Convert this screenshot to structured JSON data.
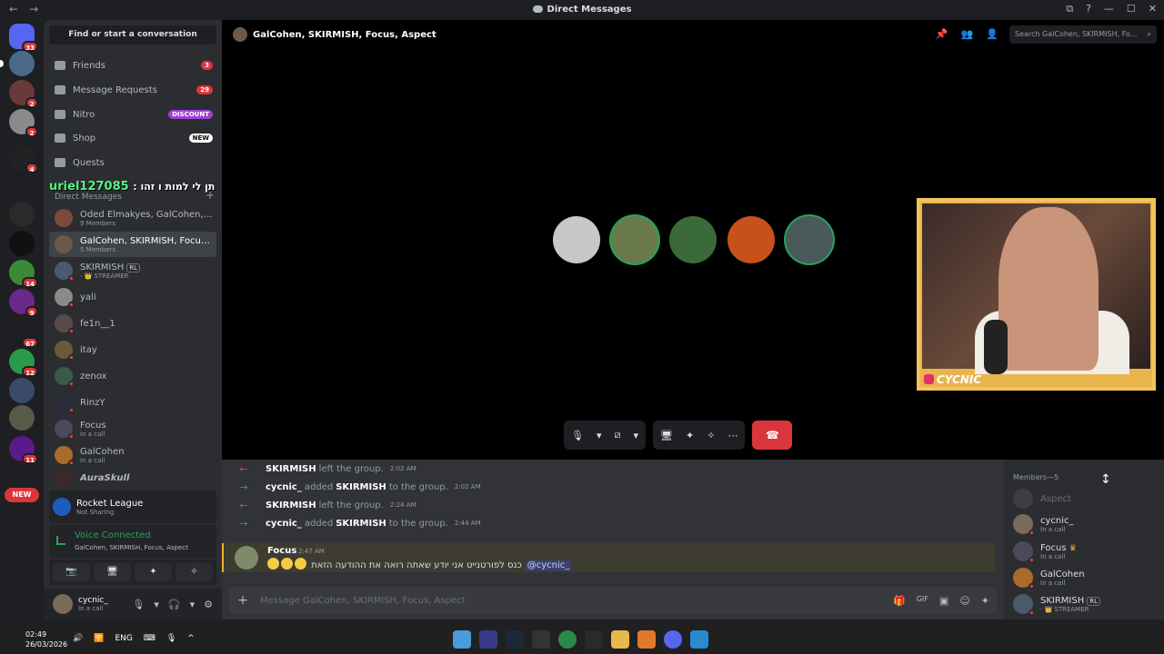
{
  "window": {
    "title": "Direct Messages",
    "nav_back": "←",
    "nav_forward": "→",
    "controls": [
      "⧉",
      "?",
      "—",
      "☐",
      "✕"
    ]
  },
  "servers": [
    {
      "name": "home",
      "badge": "33"
    },
    {
      "name": "server-1",
      "badge": ""
    },
    {
      "name": "server-2",
      "badge": "2"
    },
    {
      "name": "server-3",
      "badge": "2"
    },
    {
      "name": "server-4",
      "badge": "4"
    },
    {
      "name": "server-5",
      "badge": ""
    },
    {
      "name": "server-6",
      "badge": ""
    },
    {
      "name": "server-7",
      "badge": "14"
    },
    {
      "name": "server-8",
      "badge": "9"
    },
    {
      "name": "server-9",
      "badge": "67"
    },
    {
      "name": "server-10",
      "badge": "12"
    },
    {
      "name": "server-11",
      "badge": ""
    },
    {
      "name": "server-12",
      "badge": ""
    },
    {
      "name": "server-13",
      "badge": "11"
    }
  ],
  "new_pill": "NEW",
  "sidebar": {
    "find": "Find or start a conversation",
    "nav": [
      {
        "label": "Friends",
        "badge": "3"
      },
      {
        "label": "Message Requests",
        "badge": "29"
      },
      {
        "label": "Nitro",
        "badge": "DISCOUNT"
      },
      {
        "label": "Shop",
        "badge": "NEW"
      },
      {
        "label": "Quests",
        "badge": ""
      }
    ],
    "overlay_name": "uriel127085",
    "overlay_text": ": תן לי למות ו זהו",
    "dm_header": "Direct Messages",
    "dm_plus": "+",
    "dms": [
      {
        "name": "Oded Elmakyes, GalCohen, SK...",
        "sub": "9 Members"
      },
      {
        "name": "GalCohen, SKIRMISH, Focus, ...",
        "sub": "5 Members"
      },
      {
        "name": "SKIRMISH",
        "tag": "RL",
        "sub": "· 👑 STREAMER"
      },
      {
        "name": "yali",
        "sub": ""
      },
      {
        "name": "fe1n__1",
        "sub": ""
      },
      {
        "name": "itay",
        "sub": ""
      },
      {
        "name": "zenox",
        "sub": ""
      },
      {
        "name": "RinzY",
        "sub": ""
      },
      {
        "name": "Focus",
        "sub": "In a call"
      },
      {
        "name": "GalCohen",
        "sub": "In a call"
      },
      {
        "name": "AuraSkull",
        "sub": ""
      }
    ],
    "activity": {
      "title": "Rocket League",
      "sub": "Not Sharing"
    },
    "voice": {
      "status": "Voice Connected",
      "channel": "GalCohen, SKIRMISH, Focus, Aspect"
    },
    "voice_buttons": [
      "📷",
      "🖥",
      "✦",
      "✧"
    ],
    "user": {
      "name": "cycnic_",
      "status": "In a call"
    },
    "user_controls": [
      "🎙",
      "▾",
      "🎧",
      "▾",
      "⚙"
    ]
  },
  "header": {
    "title": "GalCohen, SKIRMISH, Focus, Aspect",
    "icons": [
      "📌",
      "👥",
      "👤"
    ],
    "search_placeholder": "Search GalCohen, SKIRMISH, Fo...",
    "search_icon": "⌕"
  },
  "call": {
    "participants": [
      "participant-1",
      "participant-2",
      "participant-3",
      "participant-4",
      "participant-5"
    ],
    "stream_label": "CYCNIC",
    "controls": {
      "mic": "🎙",
      "camera": "⧄",
      "share": "🖥",
      "activities": "✦",
      "soundboard": "✧",
      "more": "⋯",
      "hangup": "☎"
    }
  },
  "chat": {
    "system_messages": [
      {
        "arrow": "←",
        "actor": "SKIRMISH",
        "text": "left the group.",
        "target": "",
        "suffix": "",
        "time": "2:02 AM"
      },
      {
        "arrow": "→",
        "actor": "cycnic_",
        "text": "added",
        "target": "SKIRMISH",
        "suffix": "to the group.",
        "time": "2:02 AM"
      },
      {
        "arrow": "←",
        "actor": "SKIRMISH",
        "text": "left the group.",
        "target": "",
        "suffix": "",
        "time": "2:24 AM"
      },
      {
        "arrow": "→",
        "actor": "cycnic_",
        "text": "added",
        "target": "SKIRMISH",
        "suffix": "to the group.",
        "time": "2:44 AM"
      }
    ],
    "message": {
      "author": "Focus",
      "time": "2:47 AM",
      "text": "כנס לפורטנייט אני יודע שאתה רואה את ההודעה הזאת",
      "mention": "@cycnic_"
    },
    "composer_placeholder": "Message GalCohen, SKIRMISH, Focus, Aspect",
    "composer_plus": "+",
    "composer_icons": [
      "🎁",
      "GIF",
      "▣",
      "☺",
      "✦"
    ]
  },
  "members": {
    "header": "Members—5",
    "list": [
      {
        "name": "Aspect",
        "sub": "",
        "offline": true
      },
      {
        "name": "cycnic_",
        "sub": "In a call",
        "offline": false
      },
      {
        "name": "Focus",
        "sub": "In a call",
        "offline": false,
        "crown": "♛"
      },
      {
        "name": "GalCohen",
        "sub": "In a call",
        "offline": false
      },
      {
        "name": "SKIRMISH",
        "sub": "· 👑 STREAMER",
        "offline": false,
        "tag": "RL"
      }
    ]
  },
  "taskbar": {
    "time": "02:49",
    "date": "26/03/2026",
    "lang": "ENG",
    "tray_icons": [
      "🔊",
      "🛜",
      "⌨",
      "🎙",
      "^"
    ]
  },
  "colors": {
    "accent": "#5865f2",
    "danger": "#da373c",
    "online": "#23a55a",
    "highlight": "#f0b232"
  }
}
